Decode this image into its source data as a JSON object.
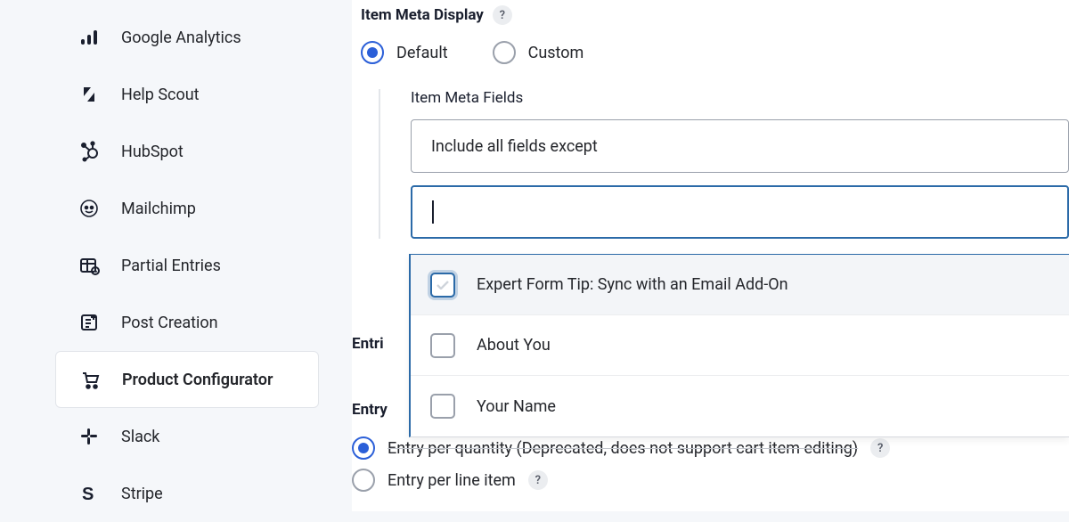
{
  "sidebar": {
    "items": [
      {
        "label": "Google Analytics",
        "icon": "analytics"
      },
      {
        "label": "Help Scout",
        "icon": "helpscout"
      },
      {
        "label": "HubSpot",
        "icon": "hubspot"
      },
      {
        "label": "Mailchimp",
        "icon": "mailchimp"
      },
      {
        "label": "Partial Entries",
        "icon": "partial"
      },
      {
        "label": "Post Creation",
        "icon": "postcreate"
      },
      {
        "label": "Product Configurator",
        "icon": "cart",
        "active": true
      },
      {
        "label": "Slack",
        "icon": "slack"
      },
      {
        "label": "Stripe",
        "icon": "stripe"
      }
    ]
  },
  "main": {
    "meta_display_label": "Item Meta Display",
    "radios": {
      "default": "Default",
      "custom": "Custom",
      "selected": "default"
    },
    "meta_fields_label": "Item Meta Fields",
    "select_value": "Include all fields except",
    "dropdown_options": [
      "Expert Form Tip: Sync with an Email Add-On",
      "About You",
      "Your Name"
    ],
    "entries_partial": "Entri",
    "entry_label_partial": "Entry",
    "entry_radios": {
      "per_quantity": "Entry per quantity (Deprecated, does not support cart item editing)",
      "per_line_item": "Entry per line item",
      "selected": "per_quantity"
    }
  }
}
